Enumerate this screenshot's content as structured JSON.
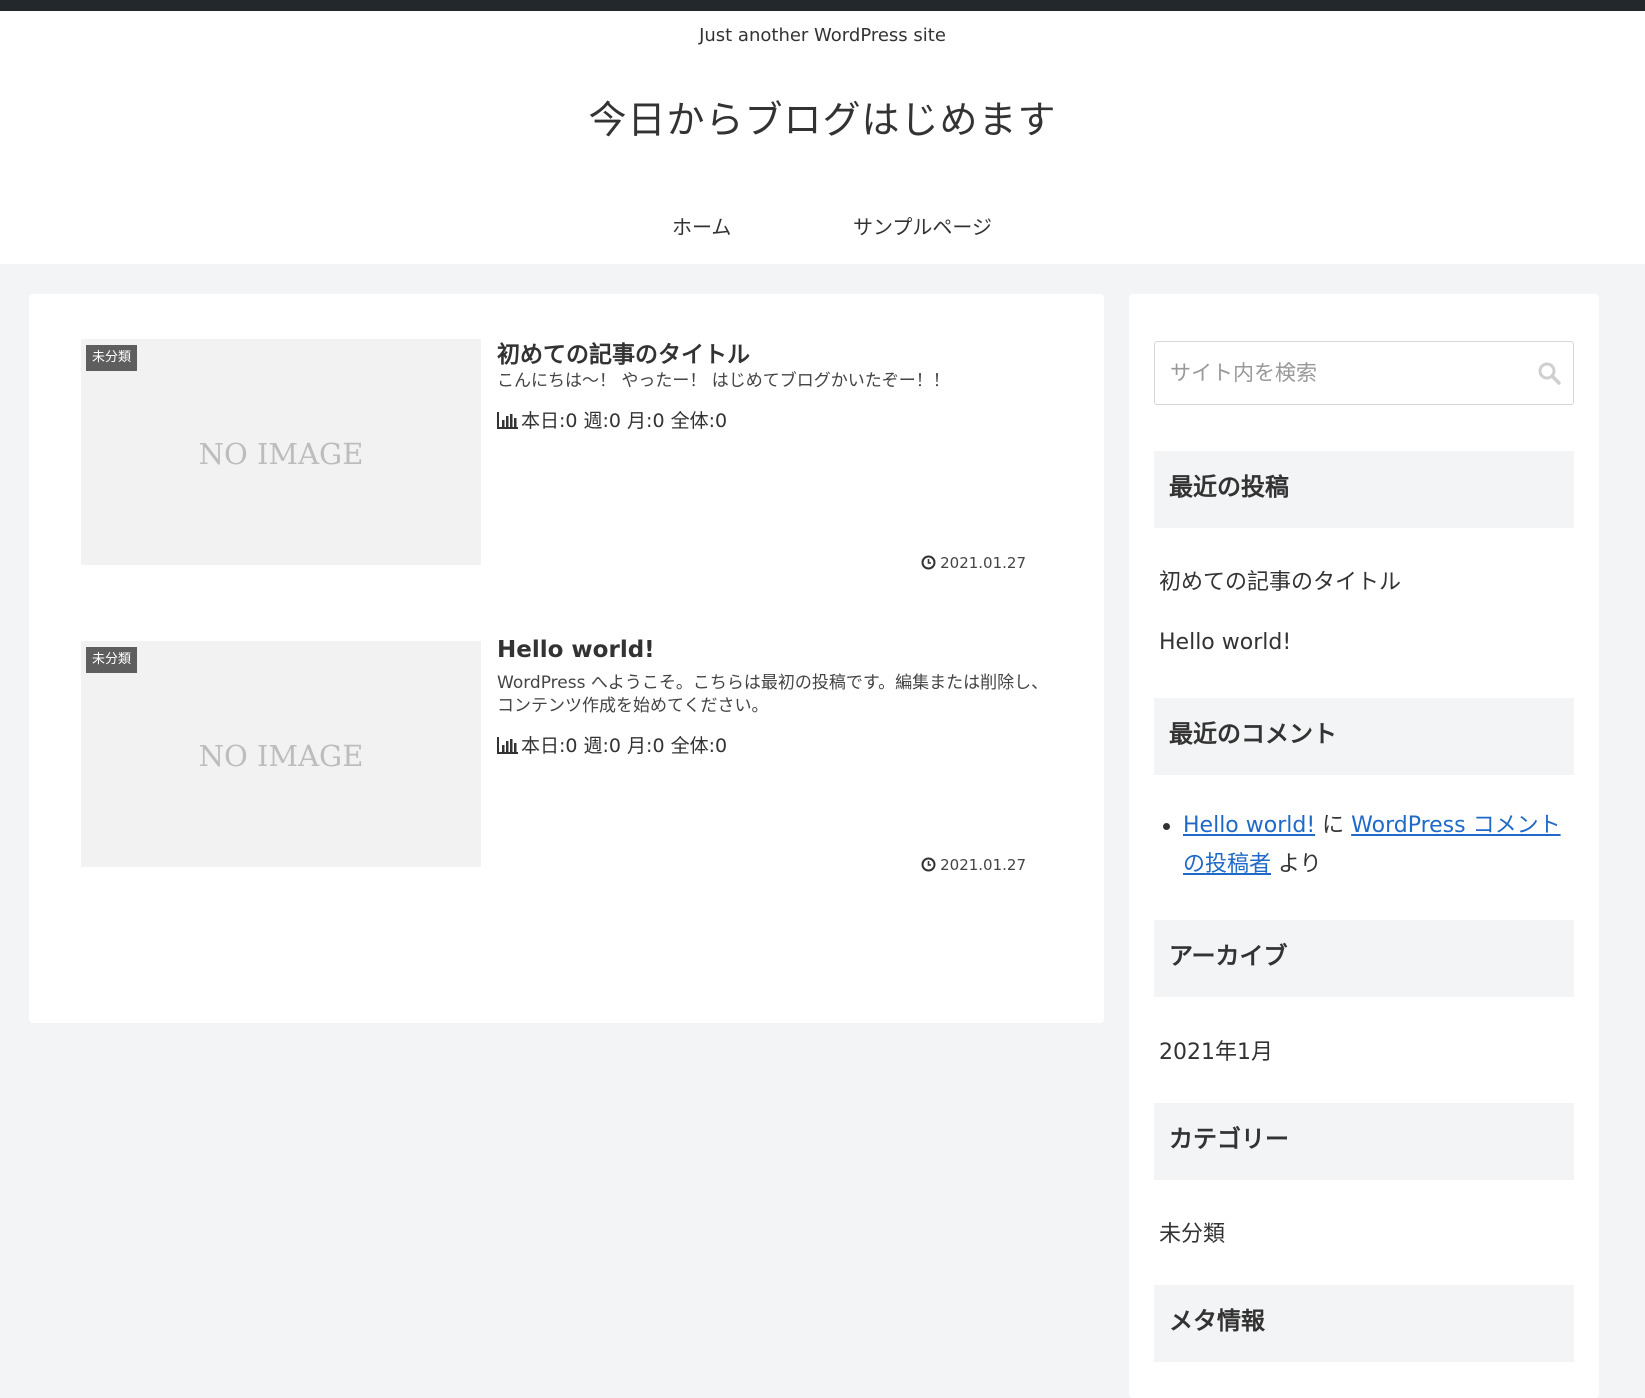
{
  "site": {
    "tagline": "Just another WordPress site",
    "title": "今日からブログはじめます"
  },
  "nav": {
    "items": [
      {
        "label": "ホーム"
      },
      {
        "label": "サンプルページ"
      }
    ]
  },
  "posts": [
    {
      "category": "未分類",
      "thumbnail_text": "NO IMAGE",
      "title": "初めての記事のタイトル",
      "excerpt": "こんにちは〜！ やったー！ はじめてブログかいたぞー！！",
      "stats": "本日:0 週:0 月:0 全体:0",
      "date": "2021.01.27"
    },
    {
      "category": "未分類",
      "thumbnail_text": "NO IMAGE",
      "title": "Hello world!",
      "excerpt": "WordPress へようこそ。こちらは最初の投稿です。編集または削除し、コンテンツ作成を始めてください。",
      "stats": "本日:0 週:0 月:0 全体:0",
      "date": "2021.01.27"
    }
  ],
  "sidebar": {
    "search": {
      "placeholder": "サイト内を検索"
    },
    "recent_posts": {
      "heading": "最近の投稿",
      "items": [
        "初めての記事のタイトル",
        "Hello world!"
      ]
    },
    "recent_comments": {
      "heading": "最近のコメント",
      "post_link": "Hello world!",
      "connector": " に ",
      "author_link": "WordPress コメントの投稿者",
      "suffix": " より"
    },
    "archives": {
      "heading": "アーカイブ",
      "items": [
        "2021年1月"
      ]
    },
    "categories": {
      "heading": "カテゴリー",
      "items": [
        "未分類"
      ]
    },
    "meta": {
      "heading": "メタ情報"
    }
  },
  "colors": {
    "adminbar": "#23282d",
    "page_bg": "#f3f4f5",
    "link": "#1f6ac8",
    "badge_bg": "#5e5e5e"
  }
}
